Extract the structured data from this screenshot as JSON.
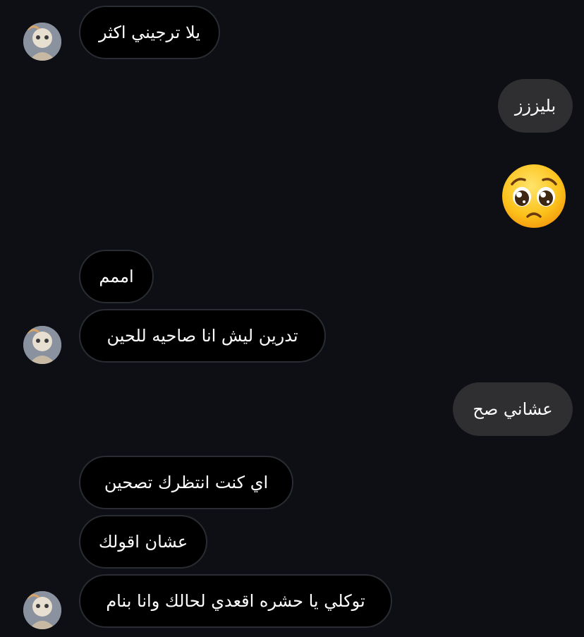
{
  "messages": [
    {
      "sender": "them",
      "text": "يلا ترجيني اكثر"
    },
    {
      "sender": "me",
      "text": "بليززز"
    },
    {
      "sender": "me",
      "emoji": "pleading-face",
      "text": "🥺"
    },
    {
      "sender": "them",
      "text": "اممم"
    },
    {
      "sender": "them",
      "text": "تدرين ليش انا صاحيه للحين"
    },
    {
      "sender": "me",
      "text": "عشاني صح"
    },
    {
      "sender": "them",
      "text": "اي كنت انتظرك تصحين"
    },
    {
      "sender": "them",
      "text": "عشان اقولك"
    },
    {
      "sender": "them",
      "text": "توكلي يا حشره اقعدي لحالك وانا بنام"
    }
  ],
  "colors": {
    "background": "#0d0f14",
    "incoming_bubble": "#000000",
    "incoming_border": "#2a2c33",
    "outgoing_bubble": "#2f2f31",
    "text": "#ffffff"
  }
}
